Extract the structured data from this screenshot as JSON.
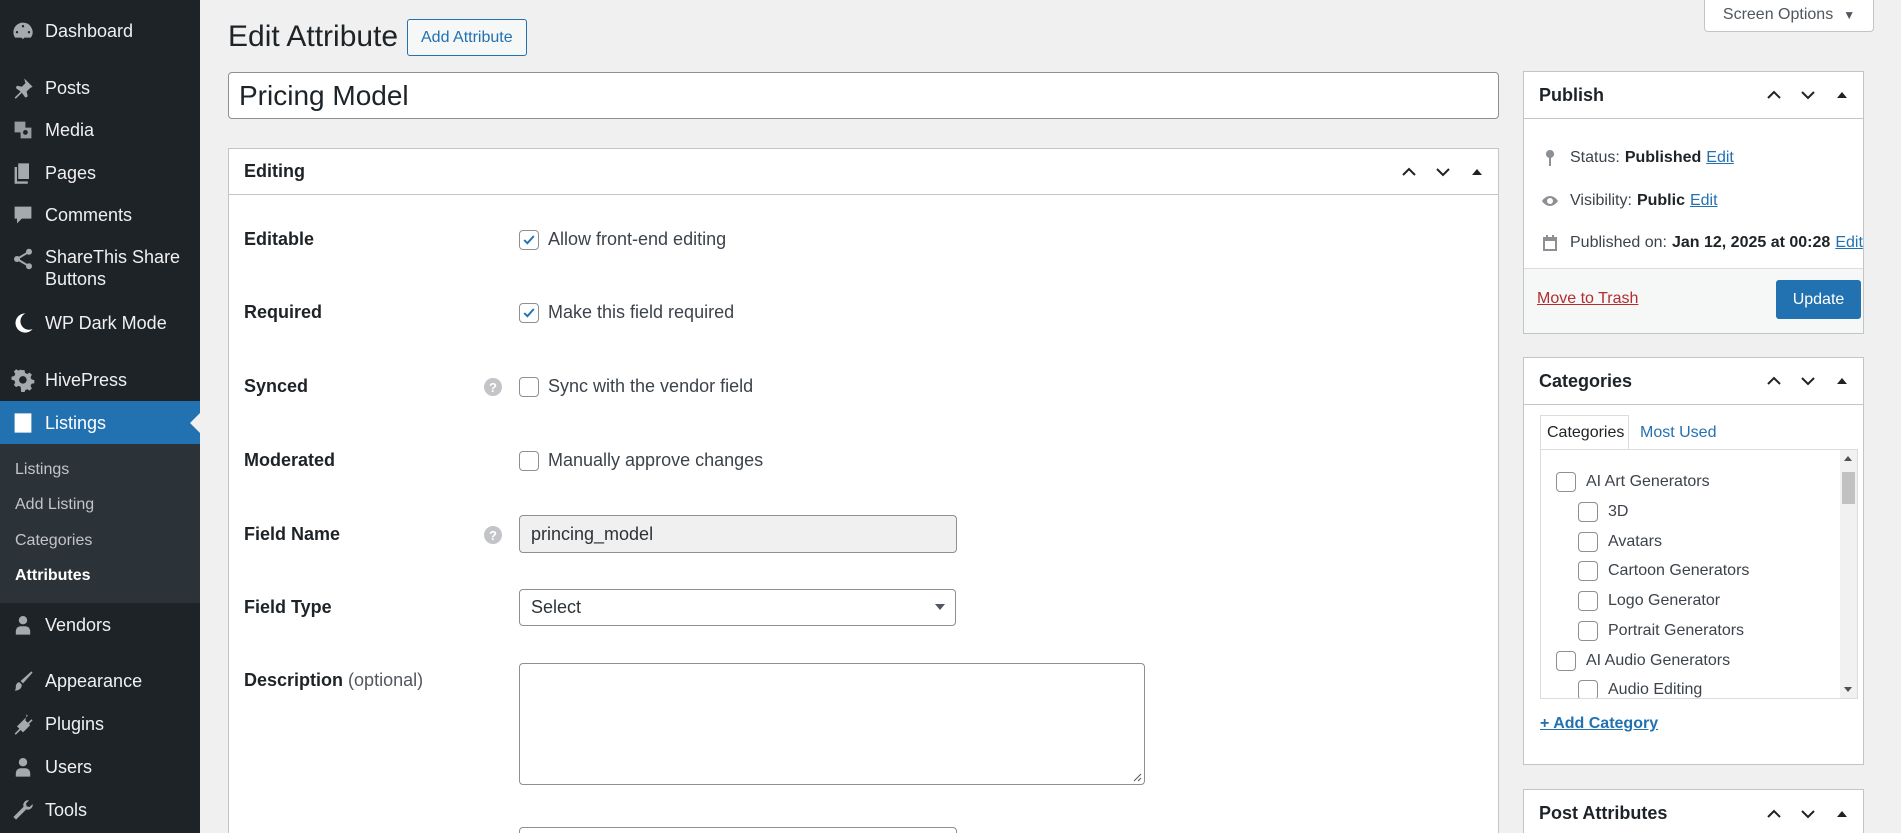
{
  "sidebar": {
    "items": [
      {
        "label": "Dashboard",
        "icon": "dashboard-icon"
      },
      {
        "label": "Posts",
        "icon": "pin-icon"
      },
      {
        "label": "Media",
        "icon": "media-icon"
      },
      {
        "label": "Pages",
        "icon": "pages-icon"
      },
      {
        "label": "Comments",
        "icon": "comments-icon"
      },
      {
        "label": "ShareThis Share Buttons",
        "icon": "share-icon"
      },
      {
        "label": "WP Dark Mode",
        "icon": "moon-icon"
      },
      {
        "label": "HivePress",
        "icon": "gear-icon"
      },
      {
        "label": "Listings",
        "icon": "listings-icon"
      },
      {
        "label": "Vendors",
        "icon": "user-icon"
      },
      {
        "label": "Appearance",
        "icon": "brush-icon"
      },
      {
        "label": "Plugins",
        "icon": "plugin-icon"
      },
      {
        "label": "Users",
        "icon": "users-icon"
      },
      {
        "label": "Tools",
        "icon": "wrench-icon"
      }
    ],
    "submenu": [
      "Listings",
      "Add Listing",
      "Categories",
      "Attributes"
    ],
    "active_submenu": "Attributes"
  },
  "header": {
    "title": "Edit Attribute",
    "add_button": "Add Attribute",
    "screen_options": "Screen Options"
  },
  "post_title": "Pricing Model",
  "editing": {
    "title": "Editing",
    "fields": {
      "editable": {
        "label": "Editable",
        "checkbox_label": "Allow front-end editing",
        "checked": true
      },
      "required": {
        "label": "Required",
        "checkbox_label": "Make this field required",
        "checked": true
      },
      "synced": {
        "label": "Synced",
        "checkbox_label": "Sync with the vendor field",
        "checked": false
      },
      "moderated": {
        "label": "Moderated",
        "checkbox_label": "Manually approve changes",
        "checked": false
      },
      "field_name": {
        "label": "Field Name",
        "value": "princing_model"
      },
      "field_type": {
        "label": "Field Type",
        "value": "Select"
      },
      "description": {
        "label": "Description",
        "optional": "(optional)",
        "value": ""
      }
    }
  },
  "publish": {
    "title": "Publish",
    "status_label": "Status:",
    "status_value": "Published",
    "visibility_label": "Visibility:",
    "visibility_value": "Public",
    "published_label": "Published on:",
    "published_value": "Jan 12, 2025 at 00:28",
    "edit_link": "Edit",
    "trash": "Move to Trash",
    "update": "Update"
  },
  "categories": {
    "title": "Categories",
    "tabs": [
      "Categories",
      "Most Used"
    ],
    "items": [
      {
        "label": "AI Art Generators",
        "level": 0
      },
      {
        "label": "3D",
        "level": 1
      },
      {
        "label": "Avatars",
        "level": 1
      },
      {
        "label": "Cartoon Generators",
        "level": 1
      },
      {
        "label": "Logo Generator",
        "level": 1
      },
      {
        "label": "Portrait Generators",
        "level": 1
      },
      {
        "label": "AI Audio Generators",
        "level": 0
      },
      {
        "label": "Audio Editing",
        "level": 1
      }
    ],
    "add_link": "+ Add Category"
  },
  "post_attributes": {
    "title": "Post Attributes"
  },
  "colors": {
    "sidebar_bg": "#1d2327",
    "accent": "#2271b1",
    "danger": "#b32d2e"
  }
}
